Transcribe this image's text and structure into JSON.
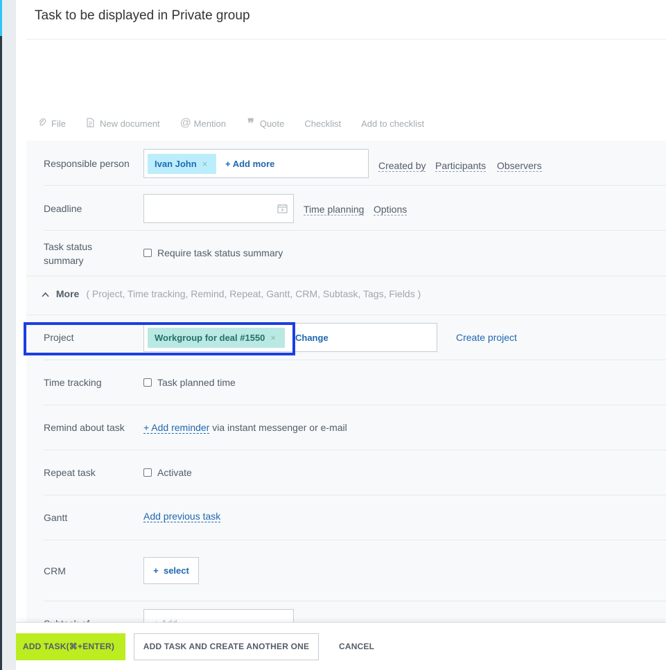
{
  "title": "Task to be displayed in Private group",
  "toolbar": {
    "file": "File",
    "new_document": "New document",
    "mention": "Mention",
    "quote": "Quote",
    "checklist": "Checklist",
    "add_to_checklist": "Add to checklist"
  },
  "responsible": {
    "label": "Responsible person",
    "tag": "Ivan John",
    "add_more": "+ Add more",
    "created_by": "Created by",
    "participants": "Participants",
    "observers": "Observers"
  },
  "deadline": {
    "label": "Deadline",
    "value": "",
    "time_planning": "Time planning",
    "options": "Options"
  },
  "status_summary": {
    "label_line1": "Task status",
    "label_line2": "summary",
    "checkbox_label": "Require task status summary"
  },
  "more": {
    "label": "More",
    "list": "( Project,  Time tracking,  Remind,  Repeat,  Gantt,  CRM,  Subtask,  Tags,  Fields )"
  },
  "project": {
    "label": "Project",
    "tag": "Workgroup for deal #1550",
    "change": "Change",
    "create": "Create project"
  },
  "time_tracking": {
    "label": "Time tracking",
    "checkbox_label": "Task planned time"
  },
  "remind": {
    "label": "Remind about task",
    "add_reminder": "+ Add reminder",
    "suffix": "via instant messenger or e-mail"
  },
  "repeat": {
    "label": "Repeat task",
    "checkbox_label": "Activate"
  },
  "gantt": {
    "label": "Gantt",
    "link": "Add previous task"
  },
  "crm": {
    "label": "CRM",
    "button": "+  select"
  },
  "subtask": {
    "label": "Subtask of",
    "add": "+ Add"
  },
  "footer": {
    "add_task": "ADD TASK(⌘+ENTER)",
    "add_and_create": "ADD TASK AND CREATE ANOTHER ONE",
    "cancel": "CANCEL"
  },
  "icons": {
    "file": "paperclip-icon",
    "new_document": "document-icon",
    "mention": "at-sign-icon",
    "quote": "quote-icon",
    "calendar": "calendar-icon",
    "chevron": "chevron-up-icon"
  },
  "colors": {
    "primary_button": "#bbed21",
    "link": "#2067b0",
    "responsible_tag": "#bcedfc",
    "project_tag": "#b9e9e2",
    "highlight_border": "#1b3fe0"
  }
}
